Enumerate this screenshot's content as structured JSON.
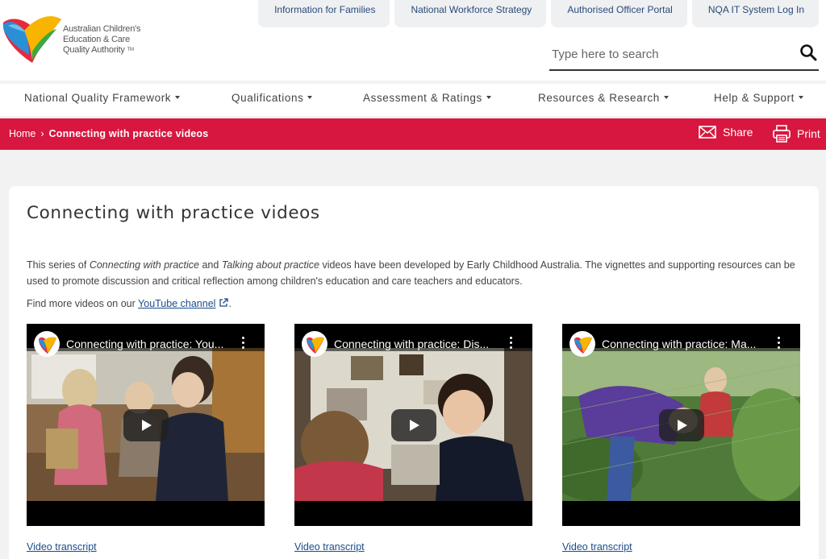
{
  "org": {
    "logo_lines": [
      "Australian Children's",
      "Education & Care",
      "Quality Authority"
    ],
    "logo_tm": "TM"
  },
  "top_links": [
    {
      "label": "Information for Families"
    },
    {
      "label": "National Workforce Strategy"
    },
    {
      "label": "Authorised Officer Portal"
    },
    {
      "label": "NQA IT System Log In"
    }
  ],
  "search": {
    "placeholder": "Type here to search",
    "icon": "search-icon"
  },
  "main_nav": [
    {
      "label": "National Quality Framework"
    },
    {
      "label": "Qualifications"
    },
    {
      "label": "Assessment & Ratings"
    },
    {
      "label": "Resources & Research"
    },
    {
      "label": "Help & Support"
    }
  ],
  "breadcrumb": {
    "home": "Home",
    "separator": "›",
    "current": "Connecting with practice videos"
  },
  "actions": {
    "share": "Share",
    "print": "Print"
  },
  "page": {
    "title": "Connecting with practice videos",
    "intro": {
      "p1": "This series of ",
      "em1": "Connecting with practice",
      "p2": " and ",
      "em2": "Talking about practice",
      "p3": " videos have been developed by Early Childhood Australia. The vignettes and supporting resources can be used to promote discussion and critical reflection among children's education and care teachers and educators."
    },
    "find_more": {
      "prefix": "Find more videos on our ",
      "link": "YouTube channel",
      "suffix": "."
    }
  },
  "videos": [
    {
      "title": "Connecting with practice: You...",
      "transcript": "Video transcript"
    },
    {
      "title": "Connecting with practice: Dis...",
      "transcript": "Video transcript"
    },
    {
      "title": "Connecting with practice: Ma...",
      "transcript": "Video transcript"
    }
  ],
  "colors": {
    "brand_red": "#d7173f",
    "link_blue": "#1a4d8c",
    "tab_bg": "#eef0f2",
    "tab_text": "#2b4a7a"
  }
}
